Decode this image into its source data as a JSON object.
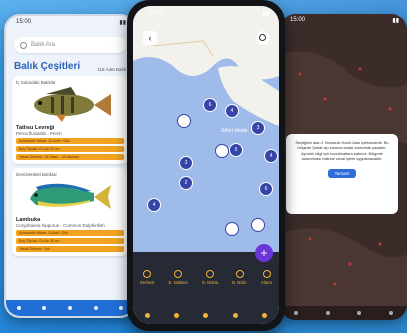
{
  "left_phone": {
    "status_time": "15:00",
    "search_placeholder": "Balık Ara",
    "title": "Balık Çeşitleri",
    "subtitle": "118 Adet Balık",
    "cards": [
      {
        "caption": "İç Sulardaki Balıklar",
        "name": "Tatlısu Levreği",
        "latin": "Perca fluviatilis - Perch",
        "bars": [
          "Avlanabilir Miktar: 20 Adet / Gün",
          "Boy Ölçüsü: En Az 20 cm",
          "Yasak Dönemi: 15 Nisan - 15 Haziran"
        ]
      },
      {
        "caption": "Denizlerdeki Balıklar",
        "name": "Lambuka",
        "latin": "Coryphaena hippurus - Common Dolphinfish",
        "bars": [
          "Avlanabilir Miktar: 5 Adet / Gün",
          "Boy Ölçüsü: En Az 35 cm",
          "Yasak Dönemi: Yok"
        ]
      }
    ]
  },
  "center_phone": {
    "status_time": "15:00",
    "map_label": "Silivri İskele",
    "cluster_counts": [
      "6",
      "4",
      "3",
      "5",
      "4",
      "3",
      "2",
      "4",
      "6"
    ],
    "fab_label": "+",
    "tools": [
      "Serbest",
      "E. Noktası",
      "N. Nokta",
      "B. Nokt.",
      "Alarm"
    ]
  },
  "right_phone": {
    "status_time": "15:00",
    "dialog_message": "Seçtiğiniz alan 1 Numaralı Kısıtlı Alan içerisindedir. Bu bölgede Şubat ayı sonuna kadar avlanmak yasaktır. Ayrıntılı bilgi için koordinatlara bakınız. Bölgede avlanılması halinde cezai işlem uygulanacaktır.",
    "ok_label": "Tamam"
  }
}
